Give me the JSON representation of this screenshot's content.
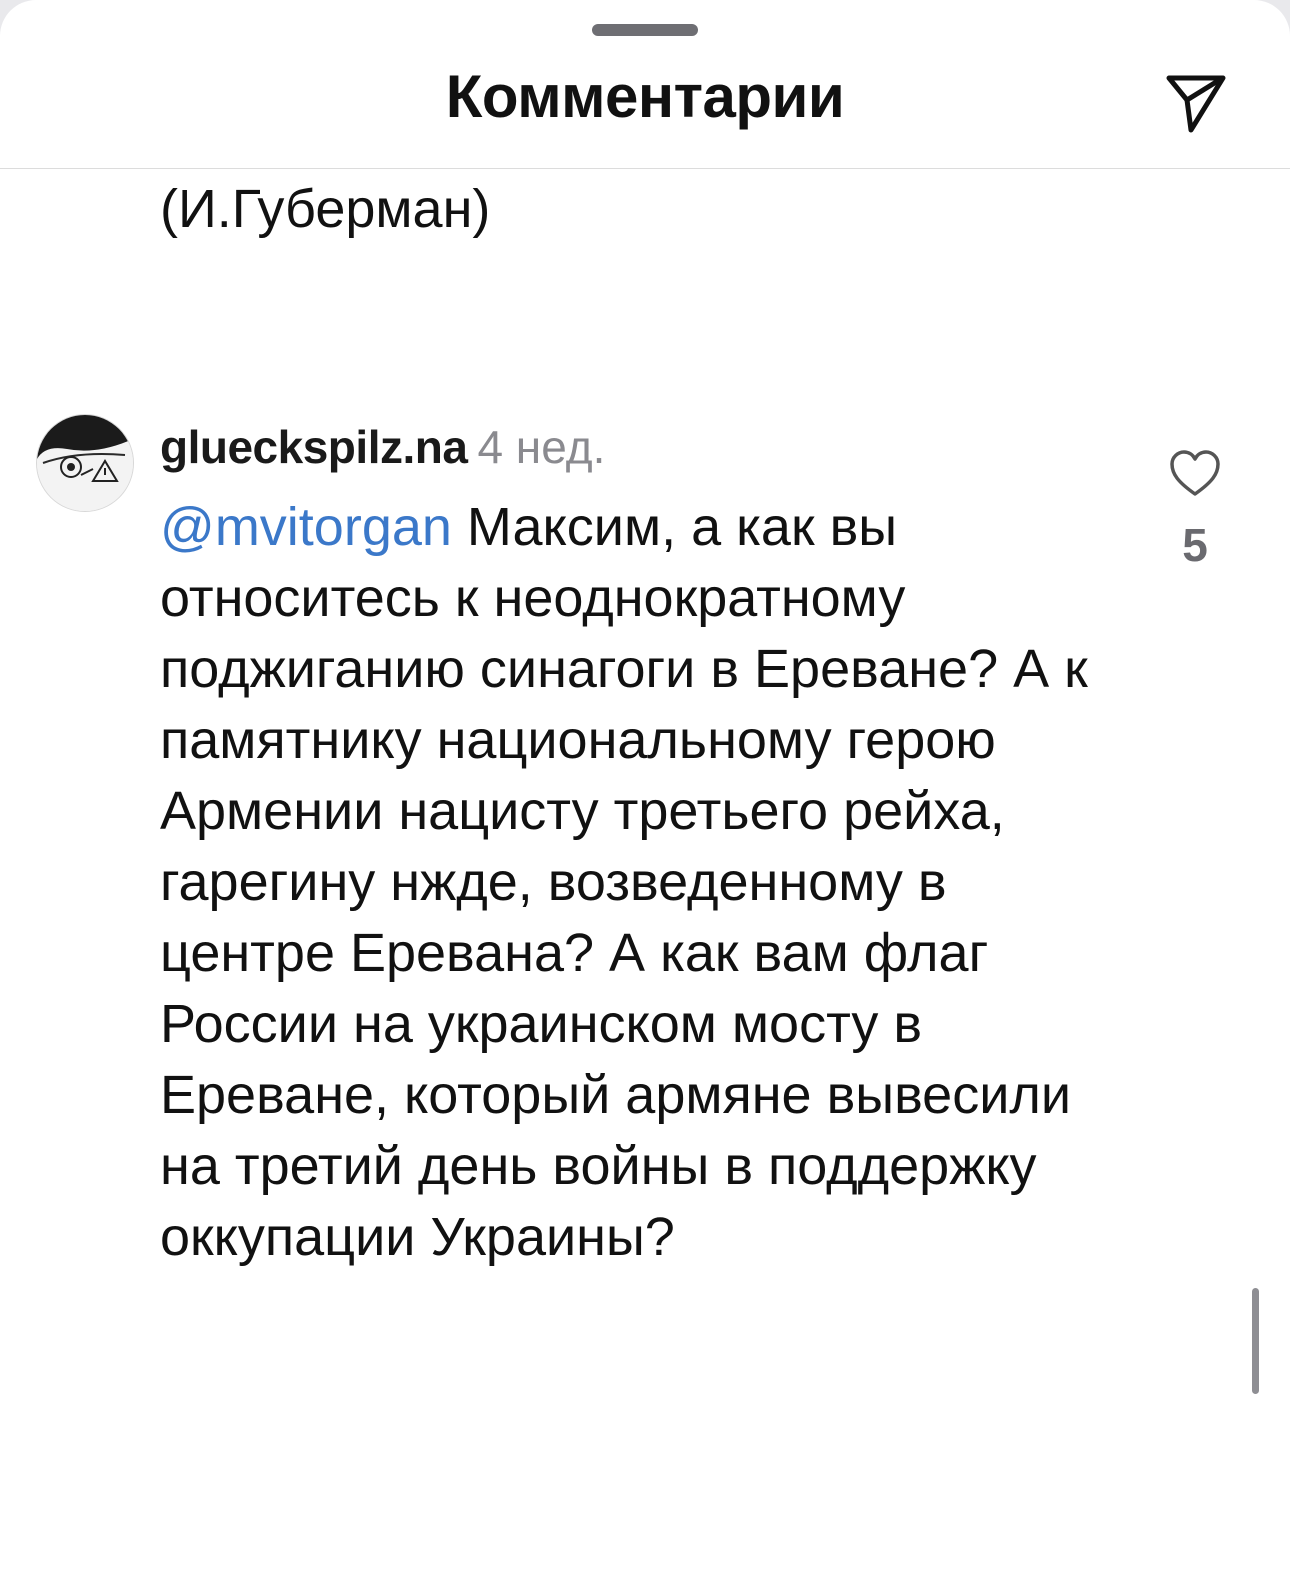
{
  "header": {
    "title": "Комментарии",
    "share_icon": "paper-plane-icon"
  },
  "previous_comment": {
    "tail_text": "(И.Губерман)"
  },
  "comment": {
    "username": "glueckspilz.na",
    "time": "4 нед.",
    "mention": "@mvitorgan",
    "text": " Максим, а как вы относитесь к неоднократному поджиганию синагоги в Ереване? А к памятнику национальному герою Армении нацисту третьего рейха, гарегину нжде, возведенному в центре Еревана? А как вам флаг России на украинском мосту в Ереване, который армяне вывесили на третий день войны в поддержку оккупации Украины?",
    "like_icon": "heart-outline-icon",
    "like_count": "5"
  },
  "colors": {
    "mention": "#3b78c9",
    "meta_gray": "#8a8a8f",
    "like_count_gray": "#6a6a6f"
  }
}
